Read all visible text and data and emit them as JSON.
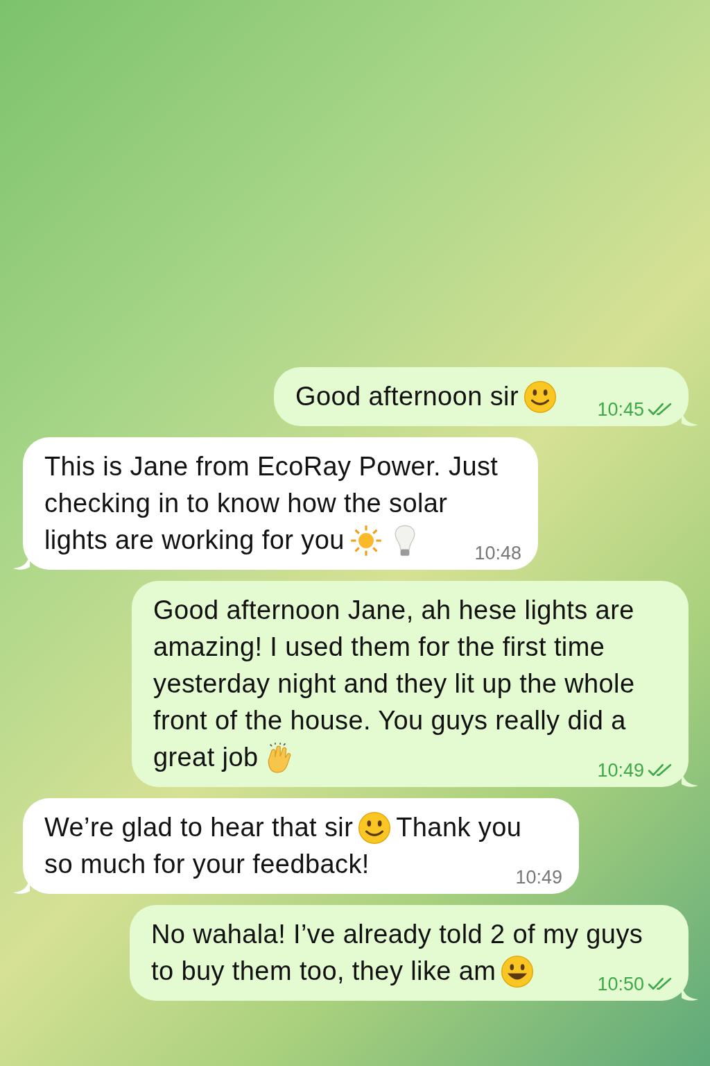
{
  "messages": [
    {
      "outgoing": true,
      "read": true,
      "time": "10:45",
      "lines": [
        [
          {
            "kind": "text",
            "text": "Good afternoon sir"
          },
          {
            "kind": "smiley"
          }
        ]
      ]
    },
    {
      "outgoing": false,
      "time": "10:48",
      "lines": [
        [
          {
            "kind": "text",
            "text": "This is Jane from EcoRay Power. Just"
          }
        ],
        [
          {
            "kind": "text",
            "text": "checking in to know how the solar"
          }
        ],
        [
          {
            "kind": "text",
            "text": "lights are working for you"
          },
          {
            "kind": "sun"
          },
          {
            "kind": "bulb"
          }
        ]
      ]
    },
    {
      "outgoing": true,
      "read": true,
      "time": "10:49",
      "lines": [
        [
          {
            "kind": "text",
            "text": "Good afternoon Jane, ah hese lights are"
          }
        ],
        [
          {
            "kind": "text",
            "text": "amazing! I used them for the first time"
          }
        ],
        [
          {
            "kind": "text",
            "text": "yesterday night and they lit up the whole"
          }
        ],
        [
          {
            "kind": "text",
            "text": "front of the house. You guys really did a"
          }
        ],
        [
          {
            "kind": "text",
            "text": "great job"
          },
          {
            "kind": "clap"
          }
        ]
      ]
    },
    {
      "outgoing": false,
      "time": "10:49",
      "lines": [
        [
          {
            "kind": "text",
            "text": "We’re glad to hear that sir"
          },
          {
            "kind": "smiley"
          },
          {
            "kind": "text",
            "text": "Thank you"
          }
        ],
        [
          {
            "kind": "text",
            "text": "so much for your feedback!"
          }
        ]
      ]
    },
    {
      "outgoing": true,
      "read": true,
      "time": "10:50",
      "lines": [
        [
          {
            "kind": "text",
            "text": "No wahala! I’ve already told 2 of my guys"
          }
        ],
        [
          {
            "kind": "text",
            "text": "to buy them too, they like am"
          },
          {
            "kind": "grin"
          }
        ]
      ]
    }
  ]
}
